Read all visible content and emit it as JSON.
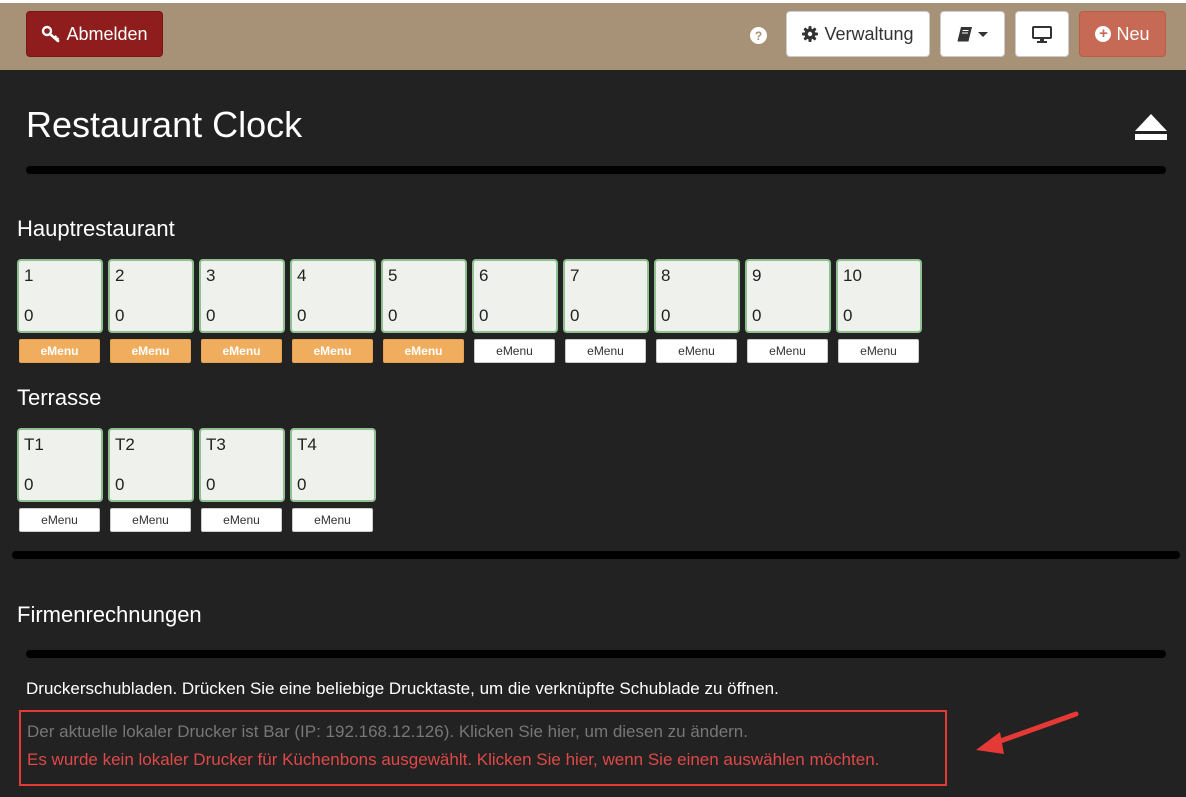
{
  "header": {
    "logout_label": "Abmelden",
    "help_label": "?",
    "admin_label": "Verwaltung",
    "new_label": "Neu",
    "new_plus": "+"
  },
  "page": {
    "title": "Restaurant Clock"
  },
  "sections": [
    {
      "title": "Hauptrestaurant",
      "tables": [
        {
          "name": "1",
          "count": "0",
          "emenu": "eMenu",
          "emenu_active": true
        },
        {
          "name": "2",
          "count": "0",
          "emenu": "eMenu",
          "emenu_active": true
        },
        {
          "name": "3",
          "count": "0",
          "emenu": "eMenu",
          "emenu_active": true
        },
        {
          "name": "4",
          "count": "0",
          "emenu": "eMenu",
          "emenu_active": true
        },
        {
          "name": "5",
          "count": "0",
          "emenu": "eMenu",
          "emenu_active": true
        },
        {
          "name": "6",
          "count": "0",
          "emenu": "eMenu",
          "emenu_active": false
        },
        {
          "name": "7",
          "count": "0",
          "emenu": "eMenu",
          "emenu_active": false
        },
        {
          "name": "8",
          "count": "0",
          "emenu": "eMenu",
          "emenu_active": false
        },
        {
          "name": "9",
          "count": "0",
          "emenu": "eMenu",
          "emenu_active": false
        },
        {
          "name": "10",
          "count": "0",
          "emenu": "eMenu",
          "emenu_active": false
        }
      ]
    },
    {
      "title": "Terrasse",
      "tables": [
        {
          "name": "T1",
          "count": "0",
          "emenu": "eMenu",
          "emenu_active": false
        },
        {
          "name": "T2",
          "count": "0",
          "emenu": "eMenu",
          "emenu_active": false
        },
        {
          "name": "T3",
          "count": "0",
          "emenu": "eMenu",
          "emenu_active": false
        },
        {
          "name": "T4",
          "count": "0",
          "emenu": "eMenu",
          "emenu_active": false
        }
      ]
    }
  ],
  "invoices": {
    "title": "Firmenrechnungen"
  },
  "printer": {
    "drawer_text": "Druckerschubladen. Drücken Sie eine beliebige Drucktaste, um die verknüpfte Schublade zu öffnen.",
    "current_printer": "Der aktuelle lokaler Drucker ist Bar (IP: 192.168.12.126). Klicken Sie hier, um diesen zu ändern.",
    "kitchen_warning": "Es wurde kein lokaler Drucker für Küchenbons ausgewählt. Klicken Sie hier, wenn Sie einen auswählen möchten."
  },
  "colors": {
    "header_bg": "#a89277",
    "page_bg": "#222222",
    "logout_bg": "#8f1d1d",
    "new_bg": "#c76a55",
    "emenu_active": "#f0ad5e",
    "table_border": "#8fc08f",
    "warning": "#e04848",
    "annotation": "#e53935"
  },
  "icons": {
    "logout": "key-icon",
    "help": "question-circle-icon",
    "admin": "gear-icon",
    "book": "book-icon",
    "monitor": "monitor-icon",
    "new": "plus-circle-icon",
    "eject": "eject-icon",
    "annotation": "arrow-icon"
  }
}
